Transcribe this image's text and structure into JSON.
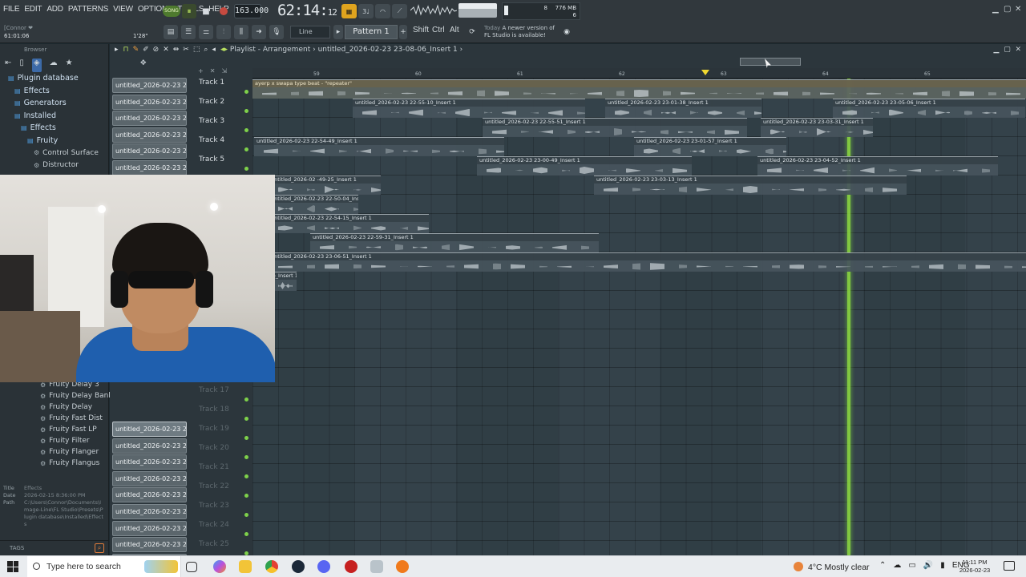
{
  "menubar": {
    "menus": [
      "FILE",
      "EDIT",
      "ADD",
      "PATTERNS",
      "VIEW",
      "OPTIONS",
      "TOOLS",
      "HELP"
    ],
    "song_label": "SONG",
    "tempo": "163.000",
    "clock_main": "62:14",
    "clock_sub": "12",
    "cpu_value": "8",
    "ram_value": "776 MB",
    "poly_value": "6",
    "hint_user": "[Connor ❤",
    "hint_time": "61:01:06",
    "hint_ratio": "1'28\"",
    "snap_label": "Line",
    "pattern_label": "Pattern 1",
    "modkeys": [
      "Shift",
      "Ctrl",
      "Alt"
    ],
    "news_today": "Today",
    "news_line1": "A newer version of",
    "news_line2": "FL Studio is available!",
    "pattern_mode_btn": "⏸"
  },
  "browser": {
    "header": "Browser",
    "tree": [
      {
        "label": "Plugin database",
        "indent": 1,
        "icon": "folder-icon"
      },
      {
        "label": "Effects",
        "indent": 2,
        "icon": "folder-icon"
      },
      {
        "label": "Generators",
        "indent": 2,
        "icon": "folder-icon"
      },
      {
        "label": "Installed",
        "indent": 2,
        "icon": "folder-icon"
      },
      {
        "label": "Effects",
        "indent": 3,
        "icon": "folder-icon"
      },
      {
        "label": "Fruity",
        "indent": 4,
        "icon": "folder-icon"
      },
      {
        "label": "Control Surface",
        "indent": 5,
        "icon": "gear-icon"
      },
      {
        "label": "Distructor",
        "indent": 5,
        "icon": "gear-icon"
      }
    ],
    "tree_lower": [
      {
        "label": "Fruity Delay 3"
      },
      {
        "label": "Fruity Delay Bank"
      },
      {
        "label": "Fruity Delay"
      },
      {
        "label": "Fruity Fast Dist"
      },
      {
        "label": "Fruity Fast LP"
      },
      {
        "label": "Fruity Filter"
      },
      {
        "label": "Fruity Flanger"
      },
      {
        "label": "Fruity Flangus"
      }
    ],
    "info": {
      "title_key": "Title",
      "title_val": "Effects",
      "date_key": "Date",
      "date_val": "2026-02-15 8:36:00 PM",
      "path_key": "Path",
      "path_val": "C:\\Users\\Connor\\Documents\\Image-Line\\FL Studio\\Presets\\Plugin database\\Installed\\Effects"
    },
    "tags_label": "TAGS"
  },
  "playlist": {
    "title": "Playlist - Arrangement",
    "project": "untitled_2026-02-23 23-08-06_Insert 1",
    "ruler_marks": [
      "59",
      "60",
      "61",
      "62",
      "63",
      "64",
      "65"
    ],
    "patterns": [
      "untitled_2026-02-23 22-",
      "untitled_2026-02-23 22-",
      "untitled_2026-02-23 22-",
      "untitled_2026-02-23 22-",
      "untitled_2026-02-23 22-",
      "untitled_2026-02-23 22-"
    ],
    "patterns_lower": [
      "untitled_2026-02-23 23-",
      "untitled_2026-02-23 23-",
      "untitled_2026-02-23 23-",
      "untitled_2026-02-23 23-",
      "untitled_2026-02-23 23-",
      "untitled_2026-02-23 23-",
      "untitled_2026-02-23 23-",
      "untitled_2026-02-23 23-",
      "untitled_2026-02-23 23-",
      "untitled_2026-02-23 23-",
      "untitled_2026-02-23 23-"
    ],
    "tracks": [
      "Track 1",
      "Track 2",
      "Track 3",
      "Track 4",
      "Track 5"
    ],
    "tracks_lower": [
      "Track 17",
      "Track 18",
      "Track 19",
      "Track 20",
      "Track 21",
      "Track 22",
      "Track 23",
      "Track 24",
      "Track 25"
    ],
    "clips": [
      {
        "name": "ayerp x swapa type beat - \"repeater\"",
        "track": 0,
        "kind": "master"
      },
      {
        "name": "untitled_2026-02-23 22-55-10_Insert 1",
        "track": 1
      },
      {
        "name": "untitled_2026-02-23 23-01-38_Insert 1",
        "track": 1
      },
      {
        "name": "untitled_2026-02-23 23-05-06_Insert 1",
        "track": 1
      },
      {
        "name": "untitled_2026-02-23 22-55-51_Insert 1",
        "track": 2
      },
      {
        "name": "untitled_2026-02-23 23-03-31_Insert 1",
        "track": 2
      },
      {
        "name": "untitled_2026-02-23 22-54-49_Insert 1",
        "track": 3
      },
      {
        "name": "untitled_2026-02-23 23-01-57_Insert 1",
        "track": 3
      },
      {
        "name": "untitled_2026-02-23 23-00-49_Insert 1",
        "track": 4
      },
      {
        "name": "untitled_2026-02-23 23-04-52_Insert 1",
        "track": 4
      },
      {
        "name": "untitled_2026-02 -49-25_Insert 1",
        "track": 5
      },
      {
        "name": "untitled_2026-02-23 23-03-13_Insert 1",
        "track": 5
      },
      {
        "name": "untitled_2026-02-23 22-50-04_Insert 1",
        "track": 6
      },
      {
        "name": "untitled_2026-02-23 22-54-15_Insert 1",
        "track": 7
      },
      {
        "name": "untitled_2026-02-23 22-59-31_Insert 1",
        "track": 8
      },
      {
        "name": "untitled_2026-02-23 23-06-51_Insert 1",
        "track": 9
      },
      {
        "name": "le_Insert 1",
        "track": 10
      }
    ]
  },
  "taskbar": {
    "search_placeholder": "Type here to search",
    "weather": "4°C  Mostly clear",
    "lang": "ENG",
    "time": "11:11 PM",
    "date": "2026-02-23"
  }
}
